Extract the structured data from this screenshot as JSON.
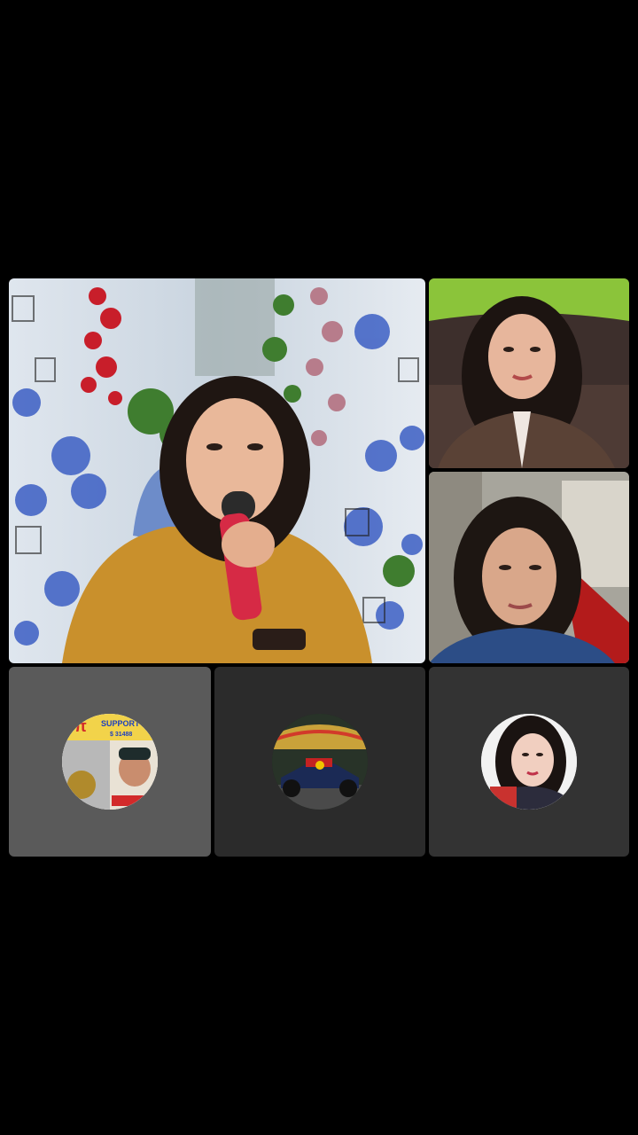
{
  "participants": [
    {
      "role": "host",
      "type": "video",
      "description_icon": "singer-video"
    },
    {
      "role": "guest",
      "type": "video",
      "description_icon": "guest-video-1"
    },
    {
      "role": "guest",
      "type": "video",
      "description_icon": "guest-video-2"
    },
    {
      "role": "guest",
      "type": "avatar",
      "avatar_text": {
        "top": "SUPPORT C",
        "sub": "$ 31488",
        "pi": "π"
      }
    },
    {
      "role": "guest",
      "type": "avatar",
      "description_icon": "race-car-avatar"
    },
    {
      "role": "guest",
      "type": "avatar",
      "description_icon": "woman-avatar"
    }
  ],
  "colors": {
    "background": "#000000",
    "avatar_tile": "#5a5a5a",
    "avatar_tile_dark": "#2b2b2b"
  }
}
